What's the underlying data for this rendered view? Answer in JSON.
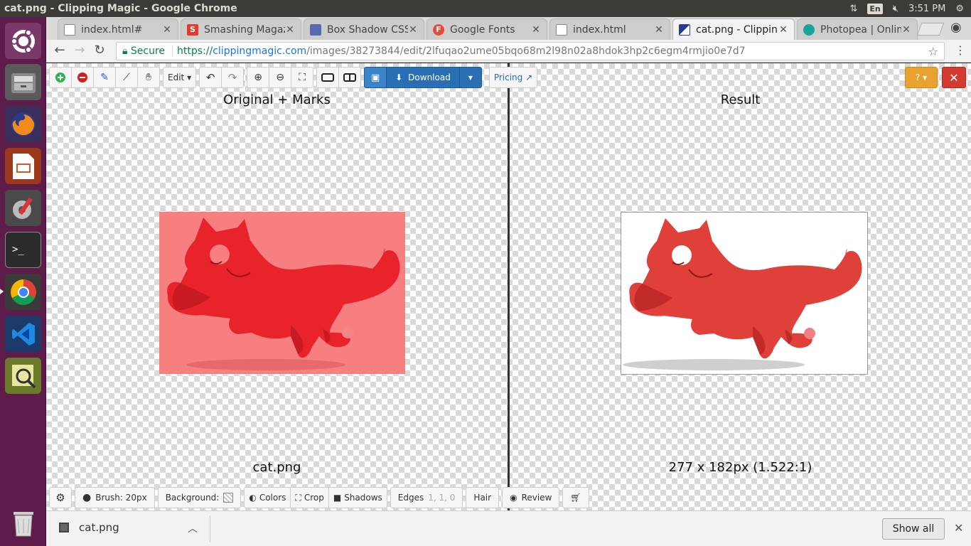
{
  "window": {
    "title": "cat.png - Clipping Magic - Google Chrome",
    "lang": "En",
    "time": "3:51 PM"
  },
  "tabs": [
    {
      "label": "index.html#",
      "icon": "file-icon",
      "active": false
    },
    {
      "label": "Smashing Magaz",
      "icon": "smashing-icon",
      "active": false
    },
    {
      "label": "Box Shadow CSS",
      "icon": "box-shadow-icon",
      "active": false
    },
    {
      "label": "Google Fonts",
      "icon": "google-fonts-icon",
      "active": false
    },
    {
      "label": "index.html",
      "icon": "file-icon",
      "active": false
    },
    {
      "label": "cat.png - Clippin",
      "icon": "clippingmagic-icon",
      "active": true
    },
    {
      "label": "Photopea | Onlin",
      "icon": "photopea-icon",
      "active": false
    }
  ],
  "omnibox": {
    "secure_label": "Secure",
    "scheme": "https://",
    "host": "clippingmagic.com",
    "path": "/images/38273844/edit/2lfuqao2ume05bqo68m2l98n02a8hdok3hp2c6egm4rmjio0e7d7"
  },
  "toolbar": {
    "edit_label": "Edit",
    "download_label": "Download",
    "pricing_label": "Pricing",
    "help_label": "?"
  },
  "panels": {
    "left_title": "Original + Marks",
    "right_title": "Result",
    "left_caption": "cat.png",
    "right_caption": "277 x 182px (1.522:1)"
  },
  "bottombar": {
    "brush_label": "Brush: 20px",
    "background_label": "Background:",
    "colors_label": "Colors",
    "crop_label": "Crop",
    "shadows_label": "Shadows",
    "edges_label": "Edges",
    "edges_value": "1, 1, 0",
    "hair_label": "Hair",
    "review_label": "Review"
  },
  "shelf": {
    "file_name": "cat.png",
    "show_all_label": "Show all"
  },
  "colors": {
    "cat": "#e8232b",
    "cat_result": "#e0403a",
    "original_bg": "#f77f80",
    "launcher": "#5e1c4a"
  }
}
